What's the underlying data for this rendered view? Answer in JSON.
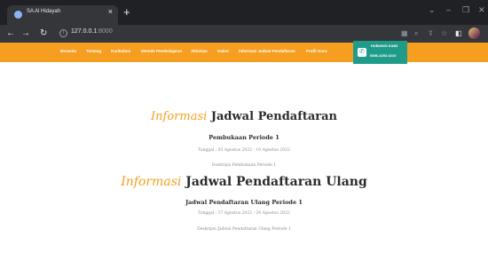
{
  "browser": {
    "tab_title": "SA Al Hidayah",
    "tab_close": "×",
    "new_tab": "+",
    "url_host": "127.0.0.1",
    "url_port": ":8000",
    "window_controls": [
      "⌄",
      "–",
      "❐",
      "✕"
    ]
  },
  "site_nav": {
    "items": [
      "Beranda",
      "Tentang",
      "Kurikulum",
      "Metode Pembelajaran",
      "Aktivitas",
      "Galeri",
      "Informasi Jadwal Pendaftaran",
      "Profil Guru"
    ],
    "contact_label": "HUBUNGI KAMI",
    "contact_phone": "0856-4283-6210"
  },
  "schedule": {
    "title_accent": "Informasi",
    "title_rest": "Jadwal Pendaftaran",
    "period_title": "Pembukaan Periode 1",
    "period_dates": "Tanggal : 03 Agustus 2022 - 10 Agustus 2022",
    "period_desc": "Deskripsi Pembukaan Periode 1"
  },
  "reschedule": {
    "title_accent": "Informasi",
    "title_rest": "Jadwal Pendaftaran Ulang",
    "period_title": "Jadwal Pendaftaran Ulang Periode 1",
    "period_dates": "Tanggal : 17 Agustus 2022 - 24 Agustus 2022",
    "period_desc": "Deskripsi Jadwal Pendaftaran Ulang Periode 1"
  },
  "colors": {
    "accent": "#f59e1f",
    "contact_bg": "#1f9b8a",
    "chrome_dark": "#202124"
  }
}
